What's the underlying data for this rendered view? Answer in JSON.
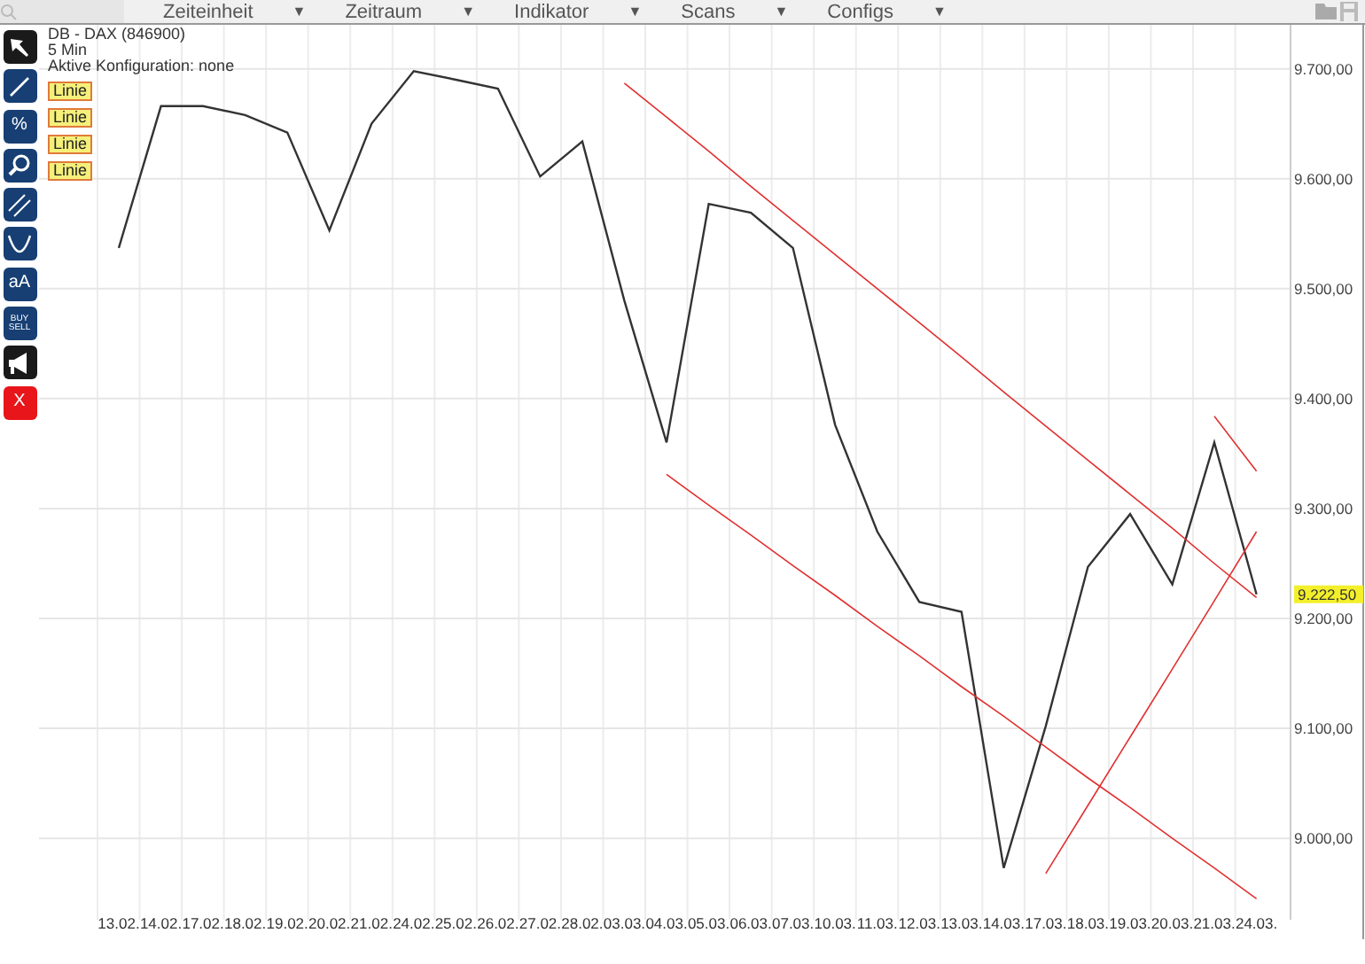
{
  "menu": [
    {
      "label": "Zeiteinheit",
      "arrow": "▼"
    },
    {
      "label": "Zeitraum",
      "arrow": "▼"
    },
    {
      "label": "Indikator",
      "arrow": "▼"
    },
    {
      "label": "Scans",
      "arrow": "▼"
    },
    {
      "label": "Configs",
      "arrow": "▼"
    }
  ],
  "toolbar": [
    {
      "kind": "pointer"
    },
    {
      "kind": "line"
    },
    {
      "kind": "percent",
      "label": "%"
    },
    {
      "kind": "zoom"
    },
    {
      "kind": "parallel"
    },
    {
      "kind": "curve"
    },
    {
      "kind": "text",
      "label": "aA"
    },
    {
      "kind": "buysell",
      "label": "BUY",
      "label2": "SELL"
    },
    {
      "kind": "alert"
    },
    {
      "kind": "delete",
      "label": "X"
    }
  ],
  "chart": {
    "interval": "5 Min",
    "config": "Aktive Konfiguration: none",
    "drawings": [
      "Linie",
      "Linie",
      "Linie",
      "Linie"
    ],
    "last_price": "9.222,50",
    "chart_data": {
      "type": "line",
      "categories": [
        "13.02.",
        "14.02.",
        "17.02.",
        "18.02.",
        "19.02.",
        "20.02.",
        "21.02.",
        "24.02.",
        "25.02.",
        "26.02.",
        "27.02.",
        "28.02.",
        "03.03.",
        "04.03.",
        "05.03.",
        "06.03.",
        "07.03.",
        "10.03.",
        "11.03.",
        "12.03.",
        "13.03.",
        "14.03.",
        "17.03.",
        "18.03.",
        "19.03.",
        "20.03.",
        "21.03.",
        "24.03."
      ],
      "series": [
        {
          "name": "DB - DAX (846900)",
          "color": "#333333",
          "values": [
            9537,
            9666,
            9666,
            9658,
            9642,
            9553,
            9650,
            9698,
            9690,
            9682,
            9602,
            9634,
            9489,
            9360,
            9577,
            9569,
            9537,
            9376,
            9279,
            9215,
            9206,
            8973,
            9102,
            9247,
            9295,
            9231,
            9360,
            9222
          ]
        },
        {
          "color": "#e03030",
          "values": [
            null,
            null,
            null,
            null,
            null,
            null,
            null,
            null,
            null,
            null,
            null,
            null,
            9687,
            9656,
            9625,
            9593,
            9562,
            9531,
            9500,
            9469,
            9438,
            9406,
            9375,
            9344,
            9313,
            9282,
            9250,
            9219
          ]
        },
        {
          "color": "#e03030",
          "values": [
            null,
            null,
            null,
            null,
            null,
            null,
            null,
            null,
            null,
            null,
            null,
            null,
            null,
            9331,
            9303,
            9276,
            9248,
            9221,
            9193,
            9166,
            9138,
            9111,
            9083,
            9055,
            9028,
            9000,
            8973,
            8945
          ]
        },
        {
          "color": "#e03030",
          "values": [
            null,
            null,
            null,
            null,
            null,
            null,
            null,
            null,
            null,
            null,
            null,
            null,
            null,
            null,
            null,
            null,
            null,
            null,
            null,
            null,
            null,
            null,
            8968,
            9030,
            9092,
            9154,
            9216,
            9279
          ]
        },
        {
          "color": "#e03030",
          "values": [
            null,
            null,
            null,
            null,
            null,
            null,
            null,
            null,
            null,
            null,
            null,
            null,
            null,
            null,
            null,
            null,
            null,
            null,
            null,
            null,
            null,
            null,
            null,
            null,
            null,
            null,
            9384,
            9334
          ]
        }
      ],
      "ylim": [
        8926,
        9740
      ],
      "grid": true,
      "yticks": [
        {
          "value": 9000,
          "label": "9.000,00"
        },
        {
          "value": 9100,
          "label": "9.100,00"
        },
        {
          "value": 9200,
          "label": "9.200,00"
        },
        {
          "value": 9300,
          "label": "9.300,00"
        },
        {
          "value": 9400,
          "label": "9.400,00"
        },
        {
          "value": 9500,
          "label": "9.500,00"
        },
        {
          "value": 9600,
          "label": "9.600,00"
        },
        {
          "value": 9700,
          "label": "9.700,00"
        }
      ]
    }
  }
}
